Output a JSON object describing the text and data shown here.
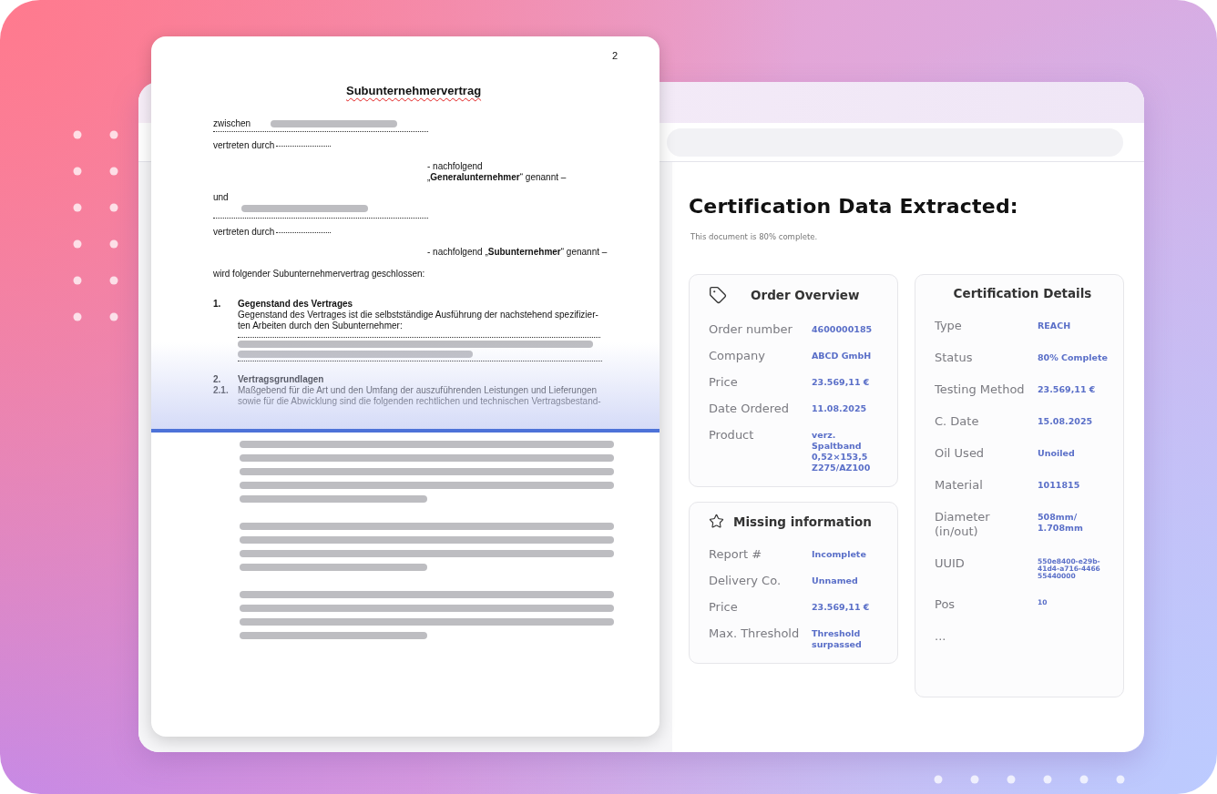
{
  "document": {
    "page_number": "2",
    "title": "Subunternehmervertrag",
    "party_1": {
      "label": "zwischen",
      "represented_by": "vertreten durch",
      "designation": [
        "- nachfolgend",
        "„**Generalunternehmer**“ genannt –"
      ]
    },
    "conjunction": "und",
    "party_2": {
      "represented_by": "vertreten durch",
      "designation": [
        "- nachfolgend „**Subunternehmer**“ genannt –"
      ]
    },
    "intro": "wird folgender Subunternehmervertrag geschlossen:",
    "sections": [
      {
        "number": "1.",
        "heading": "Gegenstand des Vertrages",
        "lines": [
          "Gegenstand des Vertrages ist die selbstständige Ausführung der nachstehend spezifizier-",
          "ten Arbeiten durch den Subunternehmer:"
        ]
      },
      {
        "number": "2.",
        "heading": "Vertragsgrundlagen",
        "sub_number": "2.1.",
        "lines": [
          "Maßgebend für die Art und den Umfang der auszuführenden Leistungen und Lieferungen",
          "sowie für die Abwicklung sind die folgenden rechtlichen und technischen Vertragsbestand-"
        ]
      }
    ]
  },
  "panel": {
    "title": "Certification Data Extracted:",
    "subtitle": "This document is 80% complete.",
    "cards": [
      {
        "title": "Order Overview",
        "kind": "tag",
        "rows": [
          {
            "label": "Order number",
            "value": "4600000185"
          },
          {
            "label": "Company",
            "value": "ABCD GmbH"
          },
          {
            "label": "Price",
            "value": "23.569,11 €"
          },
          {
            "label": "Date Ordered",
            "value": "11.08.2025"
          },
          {
            "label": "Product",
            "value": "verz. Spaltband 0,52×153,5 Z275/AZ100"
          }
        ]
      },
      {
        "title": "Missing information",
        "kind": "star",
        "rows": [
          {
            "label": "Report #",
            "value": "Incomplete"
          },
          {
            "label": "Delivery Co.",
            "value": "Unnamed"
          },
          {
            "label": "Price",
            "value": "23.569,11 €"
          },
          {
            "label": "Max. Threshold",
            "value": "Threshold surpassed"
          }
        ]
      },
      {
        "title": "Certification Details",
        "kind": "plain",
        "rows": [
          {
            "label": "Type",
            "value": "REACH"
          },
          {
            "label": "Status",
            "value": "80% Complete"
          },
          {
            "label": "Testing Method",
            "value": "23.569,11 €"
          },
          {
            "label": "C. Date",
            "value": "15.08.2025"
          },
          {
            "label": "Oil Used",
            "value": "Unoiled"
          },
          {
            "label": "Material",
            "value": "1011815"
          },
          {
            "label": "Diameter (in/out)",
            "value": "508mm/ 1.708mm"
          },
          {
            "label": "UUID",
            "value": "550e8400-e29b-41d4-a716-4466 55440000",
            "small": true
          },
          {
            "label": "Pos",
            "value": "10",
            "small": true
          },
          {
            "label": "..."
          }
        ]
      }
    ]
  }
}
